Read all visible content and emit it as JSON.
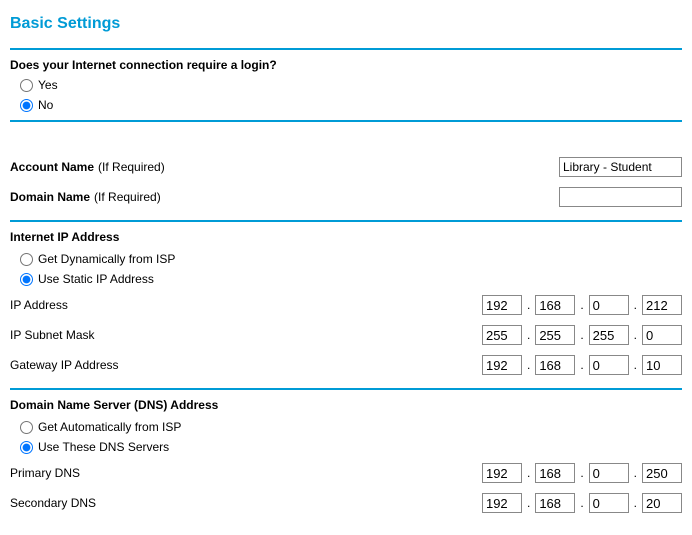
{
  "title": "Basic Settings",
  "login_question": "Does your Internet connection require a login?",
  "login_yes": "Yes",
  "login_no": "No",
  "login_selected": "no",
  "account_name_label": "Account Name",
  "account_name_hint": "(If Required)",
  "account_name_value": "Library - Student",
  "domain_name_label": "Domain Name",
  "domain_name_hint": "(If Required)",
  "domain_name_value": "",
  "ip_section_label": "Internet IP Address",
  "ip_option_dynamic": "Get Dynamically from ISP",
  "ip_option_static": "Use Static IP Address",
  "ip_selected": "static",
  "ip_address_label": "IP Address",
  "ip_address": [
    "192",
    "168",
    "0",
    "212"
  ],
  "subnet_label": "IP Subnet Mask",
  "subnet": [
    "255",
    "255",
    "255",
    "0"
  ],
  "gateway_label": "Gateway IP Address",
  "gateway": [
    "192",
    "168",
    "0",
    "10"
  ],
  "dns_section_label": "Domain Name Server (DNS) Address",
  "dns_option_auto": "Get Automatically from ISP",
  "dns_option_these": "Use These DNS Servers",
  "dns_selected": "these",
  "primary_dns_label": "Primary DNS",
  "primary_dns": [
    "192",
    "168",
    "0",
    "250"
  ],
  "secondary_dns_label": "Secondary DNS",
  "secondary_dns": [
    "192",
    "168",
    "0",
    "20"
  ]
}
